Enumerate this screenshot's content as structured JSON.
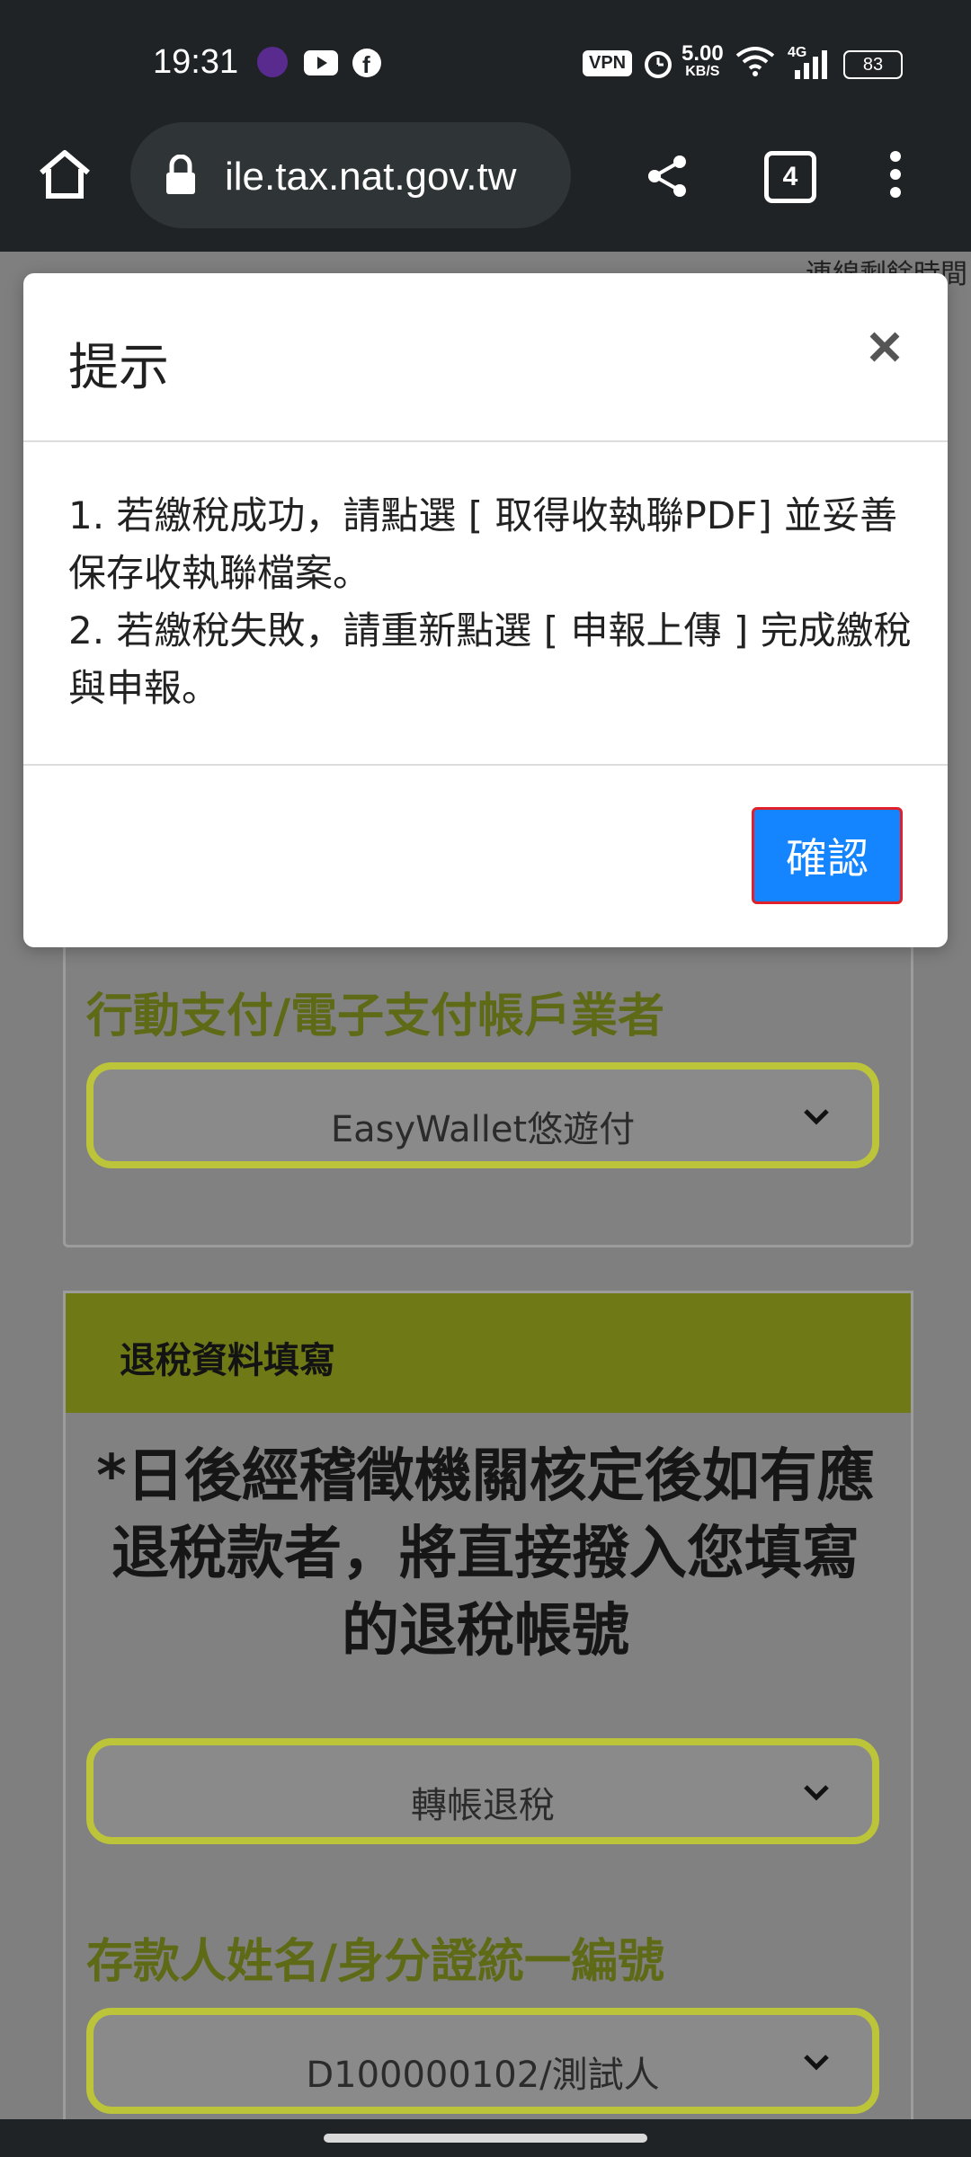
{
  "status": {
    "time": "19:31",
    "vpn": "VPN",
    "speed_value": "5.00",
    "speed_unit": "KB/S",
    "network": "4G",
    "battery": "83"
  },
  "browser": {
    "url": "ile.tax.nat.gov.tw",
    "tab_count": "4"
  },
  "page": {
    "corner_hint": "連線剩餘時間",
    "payment_label": "行動支付/電子支付帳戶業者",
    "payment_select": "EasyWallet悠遊付",
    "refund_section_title": "退稅資料填寫",
    "refund_note": "*日後經稽徵機關核定後如有應退稅款者，將直接撥入您填寫的退稅帳號",
    "refund_method_select": "轉帳退稅",
    "depositor_label": "存款人姓名/身分證統一編號",
    "depositor_select": "D100000102/測試人"
  },
  "modal": {
    "title": "提示",
    "line1": "1. 若繳稅成功，請點選 [ 取得收執聯PDF] 並妥善保存收執聯檔案。",
    "line2": "2. 若繳稅失敗，請重新點選 [ 申報上傳 ] 完成繳稅與申報。",
    "confirm": "確認"
  }
}
